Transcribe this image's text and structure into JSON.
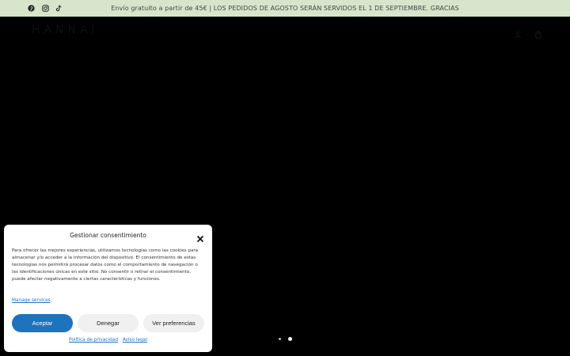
{
  "topbar": {
    "announcement": "Envío gratuito a partir de 45€ | LOS PEDIDOS DE AGOSTO SERÁN SERVIDOS EL 1 DE SEPTIEMBRE. GRACIAS",
    "social_icons": [
      "pinterest-icon",
      "instagram-icon",
      "tiktok-icon"
    ]
  },
  "header": {
    "logo": "HANNAI",
    "icons": [
      "account-icon",
      "cart-icon"
    ]
  },
  "hero": {
    "slides": 2,
    "active_slide": 2
  },
  "consent": {
    "title": "Gestionar consentimiento",
    "body": "Para ofrecer las mejores experiencias, utilizamos tecnologías como las cookies para almacenar y/o acceder a la información del dispositivo. El consentimiento de estas tecnologías nos permitirá procesar datos como el comportamiento de navegación o las identificaciones únicas en este sitio. No consentir o retirar el consentimiento, puede afectar negativamente a ciertas características y funciones.",
    "manage_link": "Manage services",
    "accept_label": "Aceptar",
    "deny_label": "Denegar",
    "prefs_label": "Ver preferencias",
    "privacy_link": "Política de privacidad",
    "legal_link": "Aviso legal"
  },
  "colors": {
    "topbar_bg": "#d7e6cb",
    "accent": "#1e73be"
  }
}
